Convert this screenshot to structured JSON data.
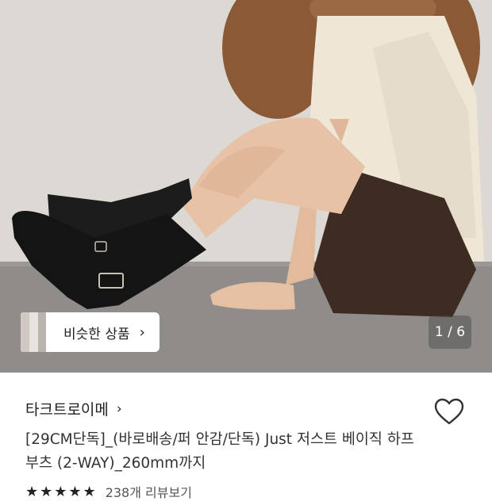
{
  "similar": {
    "label": "비슷한 상품",
    "chevron": "›"
  },
  "image_counter": "1 / 6",
  "brand": {
    "name": "타크트로이메",
    "chevron": "›"
  },
  "product": {
    "title": "[29CM단독]_(바로배송/퍼 안감/단독) Just 저스트 베이직 하프 부츠 (2-WAY)_260mm까지"
  },
  "rating": {
    "stars": "★★★★★",
    "review_text": "238개 리뷰보기"
  },
  "icons": {
    "wishlist": "heart-outline-icon",
    "similar_chevron": "chevron-right-icon"
  },
  "colors": {
    "wall": "#d9d6d1",
    "floor": "#8e8b88",
    "pill_bg": "#ffffff",
    "counter_bg": "rgba(70,70,70,0.45)"
  }
}
